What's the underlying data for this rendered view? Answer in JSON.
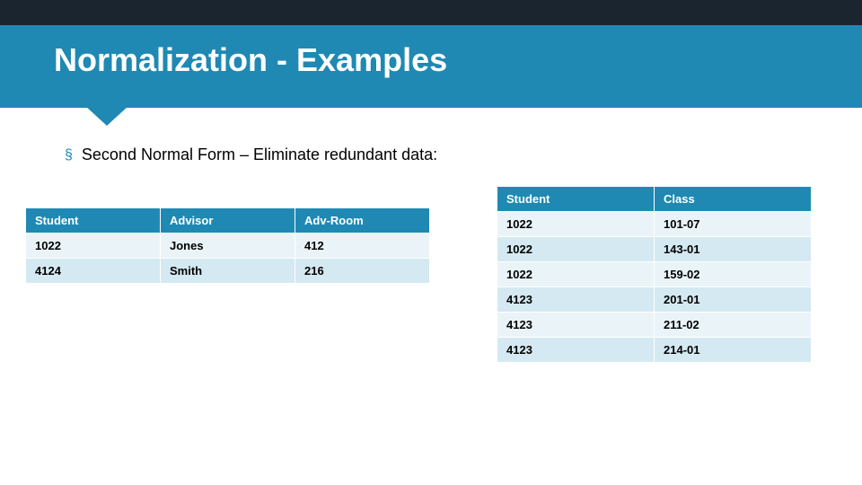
{
  "header": {
    "title": "Normalization - Examples"
  },
  "bullet": {
    "icon": "§",
    "text": "Second Normal Form – Eliminate redundant data:"
  },
  "table_left": {
    "headers": {
      "c0": "Student",
      "c1": "Advisor",
      "c2": "Adv-Room"
    },
    "rows": [
      {
        "c0": "1022",
        "c1": "Jones",
        "c2": "412"
      },
      {
        "c0": "4124",
        "c1": "Smith",
        "c2": "216"
      }
    ]
  },
  "table_right": {
    "headers": {
      "c0": "Student",
      "c1": "Class"
    },
    "rows": [
      {
        "c0": "1022",
        "c1": "101-07"
      },
      {
        "c0": "1022",
        "c1": "143-01"
      },
      {
        "c0": "1022",
        "c1": "159-02"
      },
      {
        "c0": "4123",
        "c1": "201-01"
      },
      {
        "c0": "4123",
        "c1": "211-02"
      },
      {
        "c0": "4123",
        "c1": "214-01"
      }
    ]
  },
  "chart_data": [
    {
      "type": "table",
      "title": "Student-Advisor",
      "columns": [
        "Student",
        "Advisor",
        "Adv-Room"
      ],
      "rows": [
        [
          "1022",
          "Jones",
          "412"
        ],
        [
          "4124",
          "Smith",
          "216"
        ]
      ]
    },
    {
      "type": "table",
      "title": "Student-Class",
      "columns": [
        "Student",
        "Class"
      ],
      "rows": [
        [
          "1022",
          "101-07"
        ],
        [
          "1022",
          "143-01"
        ],
        [
          "1022",
          "159-02"
        ],
        [
          "4123",
          "201-01"
        ],
        [
          "4123",
          "211-02"
        ],
        [
          "4123",
          "214-01"
        ]
      ]
    }
  ]
}
